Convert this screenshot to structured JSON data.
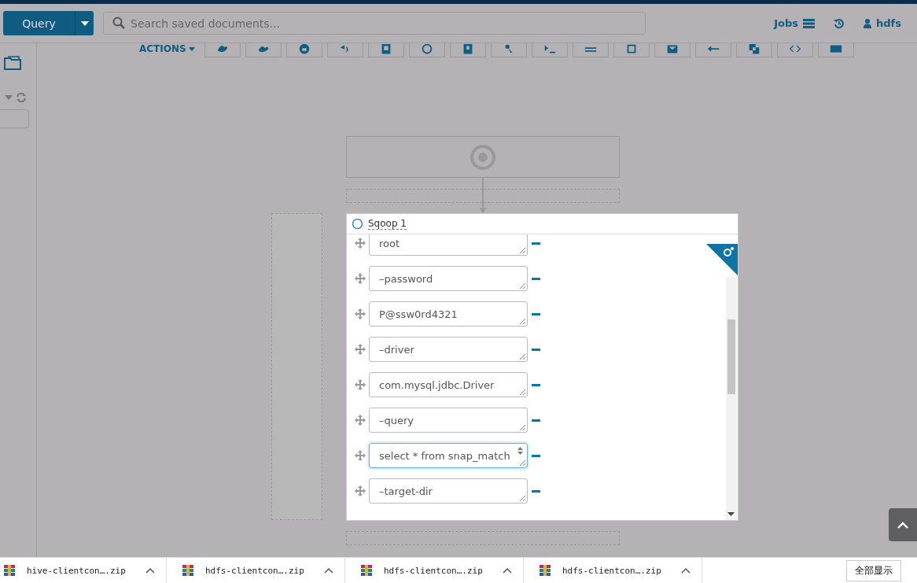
{
  "header": {
    "query_button": "Query",
    "search": {
      "placeholder": "Search saved documents..."
    },
    "jobs": "Jobs",
    "user": "hdfs"
  },
  "toolbar": {
    "actions": "ACTIONS"
  },
  "panel": {
    "title": "Sqoop 1",
    "arguments": [
      {
        "value": "root",
        "focused": false
      },
      {
        "value": "–password",
        "focused": false
      },
      {
        "value": "P@ssw0rd4321",
        "focused": false
      },
      {
        "value": "–driver",
        "focused": false
      },
      {
        "value": "com.mysql.jdbc.Driver",
        "focused": false
      },
      {
        "value": "–query",
        "focused": false
      },
      {
        "value": "select * from snap_match",
        "focused": true
      },
      {
        "value": "–target-dir",
        "focused": false
      }
    ]
  },
  "downloads": [
    {
      "name": "hive-clientcon….zip"
    },
    {
      "name": "hdfs-clientcon….zip"
    },
    {
      "name": "hdfs-clientcon….zip"
    },
    {
      "name": "hdfs-clientcon….zip"
    }
  ],
  "show_all": "全部显示"
}
